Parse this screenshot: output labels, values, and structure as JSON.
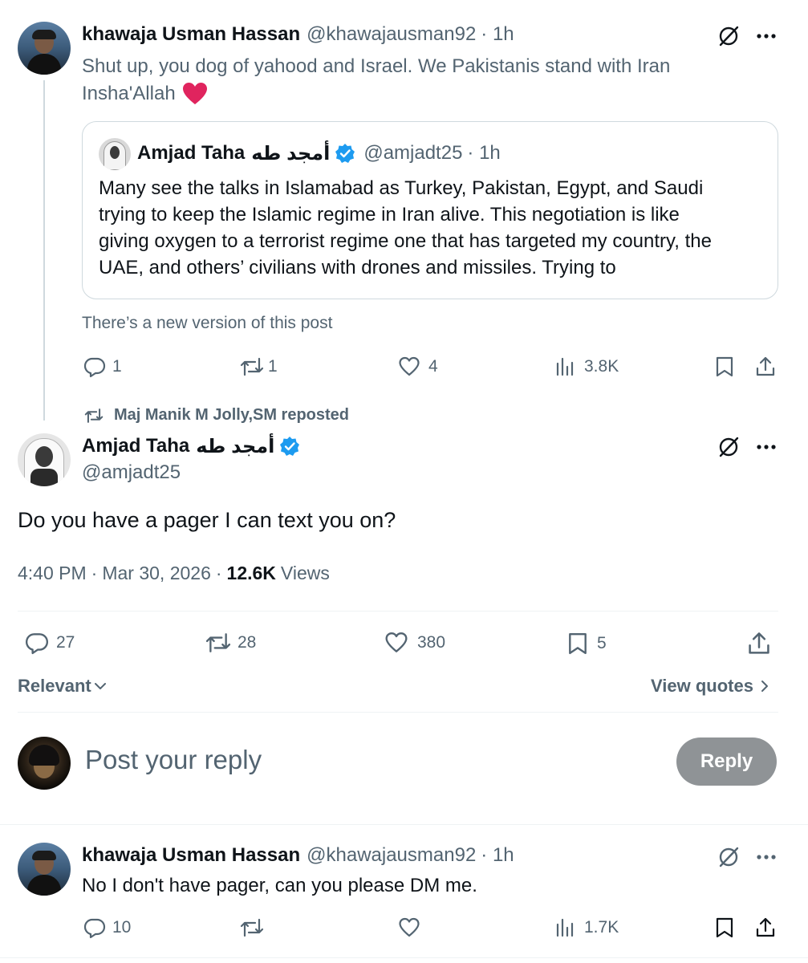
{
  "colors": {
    "text": "#0f1419",
    "muted": "#536471",
    "border": "#cfd9de",
    "verified": "#1d9bf0",
    "heart": "#e0245e",
    "reply_button": "#8f9396"
  },
  "top_post": {
    "author_name": "khawaja Usman Hassan",
    "author_handle": "@khawajausman92",
    "sep_time": "· 1h",
    "text_line1": "Shut up, you dog of yahood and Israel. We Pakistanis stand with Iran",
    "text_line2": "Insha'Allah",
    "emoji": "heart",
    "quote": {
      "name": "Amjad Taha",
      "arabic_name": "أمجد طه",
      "handle": "@amjadt25",
      "time": "· 1h",
      "lines": [
        "Many see the talks in Islamabad as Turkey, Pakistan, Egypt, and Saudi",
        "trying to keep the Islamic regime in Iran alive. This negotiation is like",
        "giving oxygen to a terrorist regime one that has targeted my country, the",
        "UAE, and others’ civilians with drones and missiles. Trying to"
      ]
    },
    "new_version_notice": "There’s a new version of this post",
    "stats": {
      "replies": "1",
      "reposts": "1",
      "likes": "4",
      "views": "3.8K"
    }
  },
  "main_post": {
    "repost_label": "Maj Manik M Jolly,SM reposted",
    "name": "Amjad Taha",
    "arabic_name": "أمجد طه",
    "handle": "@amjadt25",
    "text": "Do you have a pager I can text you on?",
    "time": "4:40 PM",
    "date": "Mar 30, 2026",
    "views_count": "12.6K",
    "views_label": "Views",
    "stats": {
      "replies": "27",
      "reposts": "28",
      "likes": "380",
      "bookmarks": "5"
    },
    "sort_label": "Relevant",
    "view_quotes": "View quotes"
  },
  "composer": {
    "placeholder": "Post your reply",
    "reply_button": "Reply"
  },
  "reply_post": {
    "author_name": "khawaja Usman Hassan",
    "author_handle": "@khawajausman92",
    "sep_time": "· 1h",
    "text": "No I don't have pager, can you please DM me.",
    "stats": {
      "replies": "10",
      "views": "1.7K"
    }
  },
  "icons": [
    "grok-icon",
    "more-icon",
    "verified-icon",
    "reply-icon",
    "repost-icon",
    "like-icon",
    "views-icon",
    "bookmark-icon",
    "share-icon",
    "chevron-down-icon",
    "chevron-right-icon",
    "heart-emoji"
  ]
}
